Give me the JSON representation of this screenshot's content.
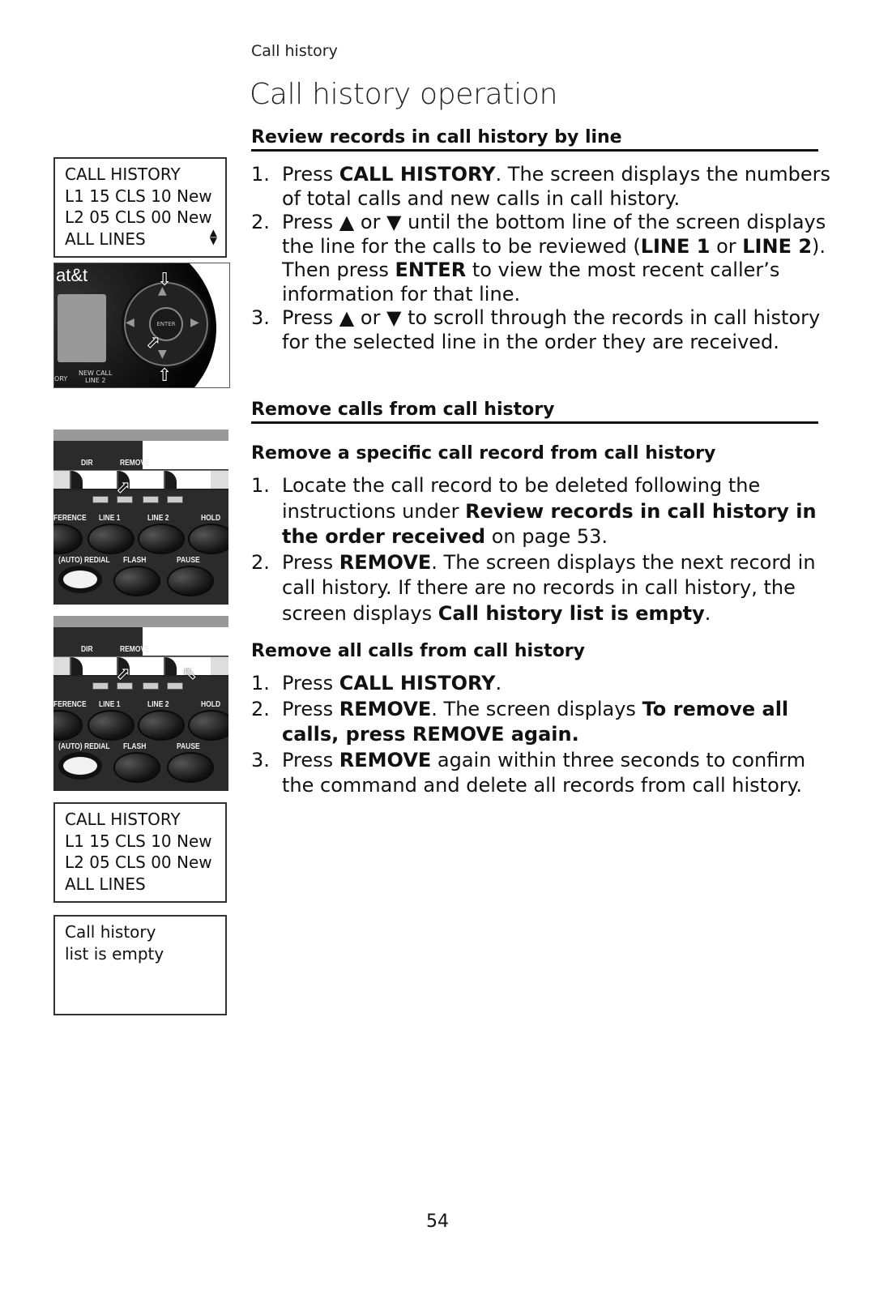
{
  "header": {
    "section": "Call history",
    "title": "Call history operation"
  },
  "review": {
    "heading": "Review records in call history by line",
    "steps": [
      {
        "num": "1.",
        "parts": [
          [
            "Press ",
            false
          ],
          [
            "CALL HISTORY",
            true
          ],
          [
            ". The screen displays the numbers of total calls and new calls in call history.",
            false
          ]
        ]
      },
      {
        "num": "2.",
        "parts": [
          [
            "Press ▲ or ▼ until the bottom line of the screen displays the line for the calls to be reviewed (",
            false
          ],
          [
            "LINE 1",
            true
          ],
          [
            " or ",
            false
          ],
          [
            "LINE 2",
            true
          ],
          [
            "). Then press ",
            false
          ],
          [
            "ENTER",
            true
          ],
          [
            " to view the most recent caller’s information for that line.",
            false
          ]
        ]
      },
      {
        "num": "3.",
        "parts": [
          [
            "Press ▲ or ▼ to scroll through the records in call history for the selected line in the order they are received.",
            false
          ]
        ]
      }
    ]
  },
  "remove": {
    "heading": "Remove calls from call history",
    "specific": {
      "heading": "Remove a specific call record from call history",
      "steps": [
        {
          "num": "1.",
          "parts": [
            [
              "Locate the call record to be deleted following the instructions under ",
              false
            ],
            [
              "Review records in call history in the order received",
              true
            ],
            [
              " on page 53.",
              false
            ]
          ]
        },
        {
          "num": "2.",
          "parts": [
            [
              "Press ",
              false
            ],
            [
              "REMOVE",
              true
            ],
            [
              ". The screen displays the next record in call history. If there are no records in call history, the screen displays ",
              false
            ],
            [
              "Call history list is empty",
              true
            ],
            [
              ".",
              false
            ]
          ]
        }
      ]
    },
    "all": {
      "heading": "Remove all calls from call history",
      "steps": [
        {
          "num": "1.",
          "parts": [
            [
              "Press ",
              false
            ],
            [
              "CALL HISTORY",
              true
            ],
            [
              ".",
              false
            ]
          ]
        },
        {
          "num": "2.",
          "parts": [
            [
              "Press ",
              false
            ],
            [
              "REMOVE",
              true
            ],
            [
              ". The screen displays ",
              false
            ],
            [
              "To remove all calls, press REMOVE again.",
              true
            ]
          ]
        },
        {
          "num": "3.",
          "parts": [
            [
              "Press ",
              false
            ],
            [
              "REMOVE",
              true
            ],
            [
              " again within three seconds to confirm the command and delete all records from call history.",
              false
            ]
          ]
        }
      ]
    }
  },
  "figures": {
    "lcd1": {
      "lines": [
        "CALL HISTORY",
        "L1 15 CLS 10 New",
        "L2 05 CLS 00 New",
        "ALL LINES"
      ],
      "scroll_icon": "▲▼"
    },
    "navpad": {
      "brand": "at&t",
      "enter": "ENTER",
      "label_left": "ORY",
      "label_newcall": "NEW CALL",
      "label_line2": "LINE 2"
    },
    "keypad": {
      "dir": "DIR",
      "remove": "REMOVE",
      "ference": "FERENCE",
      "line1": "LINE 1",
      "line2": "LINE 2",
      "hold": "HOLD",
      "redial": "(AUTO) REDIAL",
      "flash": "FLASH",
      "pause": "PAUSE"
    },
    "lcd2": {
      "lines": [
        "CALL HISTORY",
        "L1 15 CLS 10 New",
        "L2 05 CLS 00 New",
        "ALL LINES"
      ]
    },
    "lcd3": {
      "lines": [
        "Call history",
        "list is empty"
      ]
    }
  },
  "footer": {
    "page_number": "54"
  }
}
